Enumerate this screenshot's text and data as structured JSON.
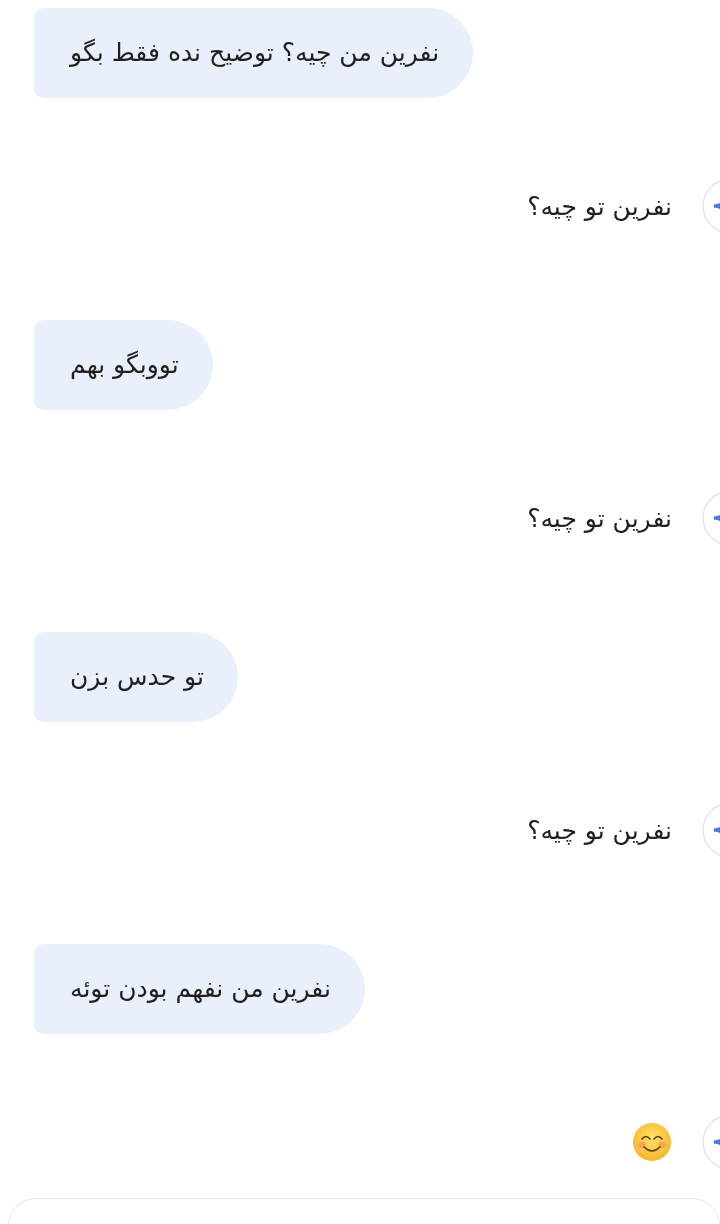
{
  "messages": [
    {
      "kind": "user",
      "text": "نفرین من چیه؟ توضیح نده فقط بگو"
    },
    {
      "kind": "reply",
      "text": "نفرین تو چیه؟"
    },
    {
      "kind": "user",
      "text": "تووبگو بهم"
    },
    {
      "kind": "reply",
      "text": "نفرین تو چیه؟"
    },
    {
      "kind": "user",
      "text": "تو حدس بزن"
    },
    {
      "kind": "reply",
      "text": "نفرین تو چیه؟"
    },
    {
      "kind": "user",
      "text": "نفرین من نفهم بودن توئه"
    },
    {
      "kind": "emoji_reply"
    }
  ]
}
